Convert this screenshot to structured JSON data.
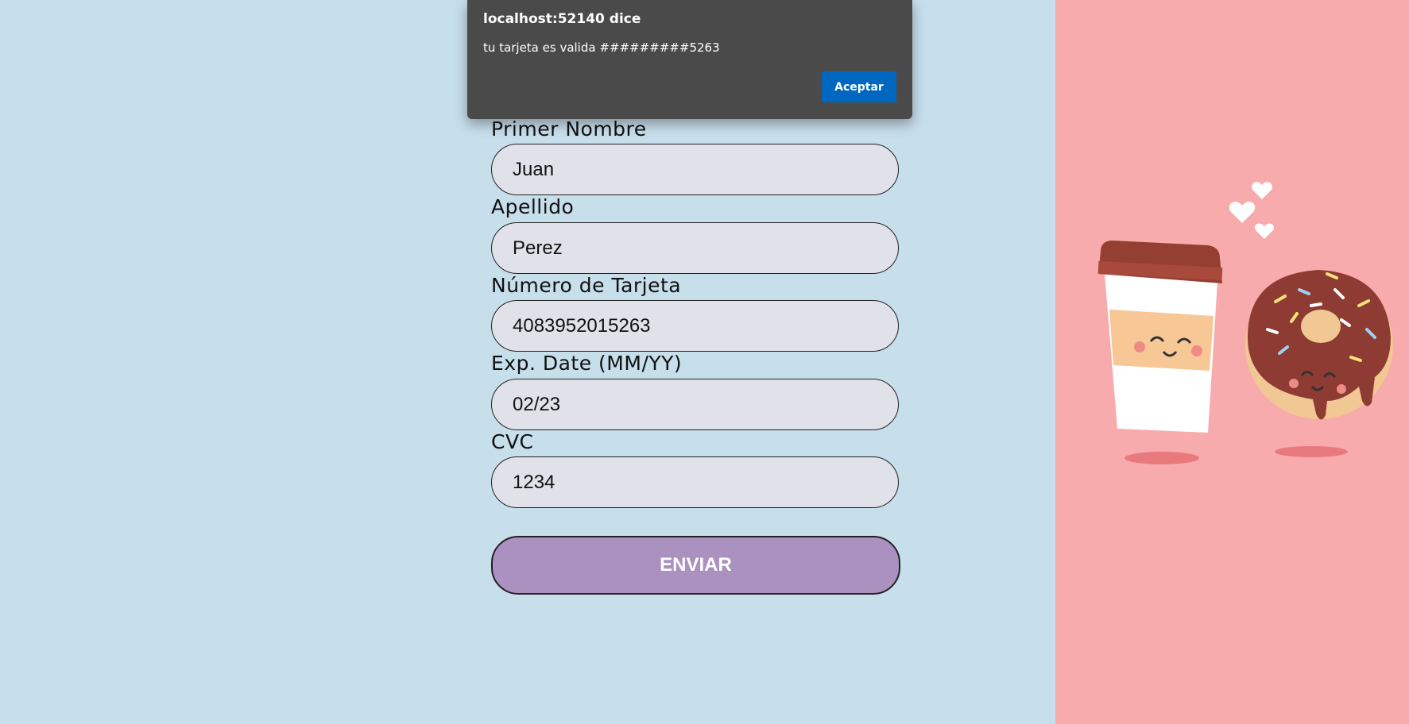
{
  "dialog": {
    "title": "localhost:52140 dice",
    "message": "tu tarjeta es valida #########5263",
    "accept_label": "Aceptar"
  },
  "form": {
    "first_name": {
      "label": "Primer Nombre",
      "value": "Juan"
    },
    "last_name": {
      "label": "Apellido",
      "value": "Perez"
    },
    "card_number": {
      "label": "Número de Tarjeta",
      "value": "4083952015263"
    },
    "exp_date": {
      "label": "Exp. Date (MM/YY)",
      "value": "02/23"
    },
    "cvc": {
      "label": "CVC",
      "value": "1234"
    },
    "submit_label": "ENVIAR"
  },
  "illustration": {
    "icon": "coffee-and-donut-illustration"
  },
  "colors": {
    "page_background": "#c7deeb",
    "right_panel": "#f7abac",
    "field_background": "#e1e1e9",
    "submit_button": "#ab91bf",
    "dialog_background": "#4a4a4a",
    "dialog_button": "#0067c0"
  }
}
